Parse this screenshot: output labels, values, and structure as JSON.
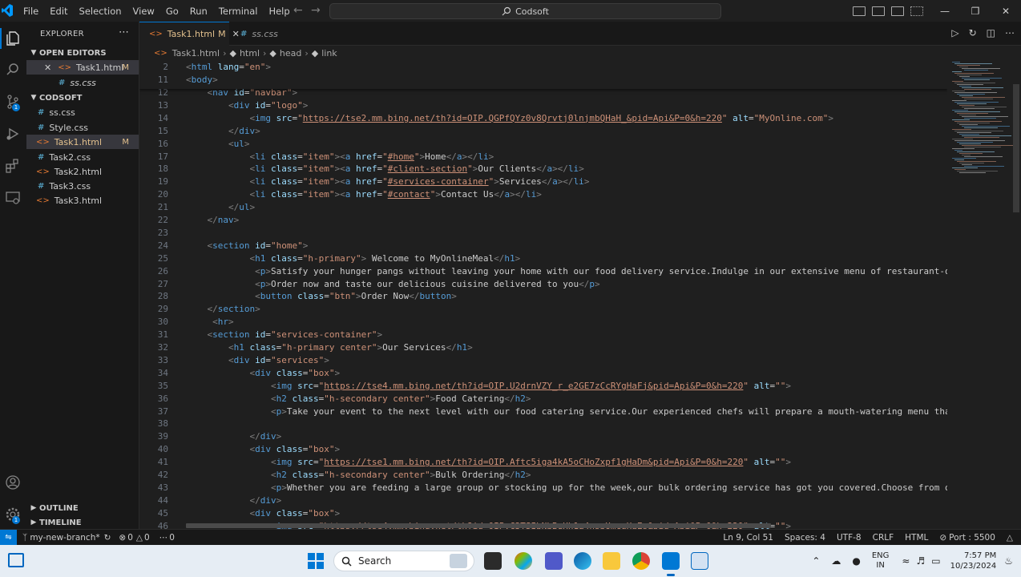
{
  "menu": [
    "File",
    "Edit",
    "Selection",
    "View",
    "Go",
    "Run",
    "Terminal",
    "Help"
  ],
  "command_center": "Codsoft",
  "explorer": {
    "title": "EXPLORER",
    "open_editors_label": "OPEN EDITORS",
    "open_editors": [
      {
        "name": "Task1.html",
        "status": "M"
      },
      {
        "name": "ss.css",
        "status": ""
      }
    ],
    "folder_label": "CODSOFT",
    "files": [
      {
        "name": "ss.css",
        "status": ""
      },
      {
        "name": "Style.css",
        "status": ""
      },
      {
        "name": "Task1.html",
        "status": "M"
      },
      {
        "name": "Task2.css",
        "status": ""
      },
      {
        "name": "Task2.html",
        "status": ""
      },
      {
        "name": "Task3.css",
        "status": ""
      },
      {
        "name": "Task3.html",
        "status": ""
      }
    ],
    "outline_label": "OUTLINE",
    "timeline_label": "TIMELINE"
  },
  "tabs": [
    {
      "name": "Task1.html",
      "status": "M"
    },
    {
      "name": "ss.css",
      "status": ""
    }
  ],
  "breadcrumb": [
    "Task1.html",
    "html",
    "head",
    "link"
  ],
  "code_lines": [
    {
      "n": "2",
      "html": "<span class=\"t\">&lt;</span><span class=\"n\">html</span> <span class=\"a\">lang</span><span class=\"x\">=</span><span class=\"s\">\"en\"</span><span class=\"t\">&gt;</span>"
    },
    {
      "n": "11",
      "html": "<span class=\"t\">&lt;</span><span class=\"n\">body</span><span class=\"t\">&gt;</span>"
    },
    {
      "n": "12",
      "html": "    <span class=\"t\">&lt;</span><span class=\"n\">nav</span> <span class=\"a\">id</span><span class=\"x\">=</span><span class=\"s\">\"navbar\"</span><span class=\"t\">&gt;</span>"
    },
    {
      "n": "13",
      "html": "        <span class=\"t\">&lt;</span><span class=\"n\">div</span> <span class=\"a\">id</span><span class=\"x\">=</span><span class=\"s\">\"logo\"</span><span class=\"t\">&gt;</span>"
    },
    {
      "n": "14",
      "html": "            <span class=\"t\">&lt;</span><span class=\"n\">img</span> <span class=\"a\">src</span><span class=\"x\">=</span><span class=\"s\">\"</span><span class=\"u\">https://tse2.mm.bing.net/th?id=OIP.QGPfQYz0v8Qrvtj0lnjmbQHaH_&amp;pid=Api&amp;P=0&amp;h=220</span><span class=\"s\">\"</span> <span class=\"a\">alt</span><span class=\"x\">=</span><span class=\"s\">\"MyOnline.com\"</span><span class=\"t\">&gt;</span>"
    },
    {
      "n": "15",
      "html": "        <span class=\"t\">&lt;/</span><span class=\"n\">div</span><span class=\"t\">&gt;</span>"
    },
    {
      "n": "16",
      "html": "        <span class=\"t\">&lt;</span><span class=\"n\">ul</span><span class=\"t\">&gt;</span>"
    },
    {
      "n": "17",
      "html": "            <span class=\"t\">&lt;</span><span class=\"n\">li</span> <span class=\"a\">class</span><span class=\"x\">=</span><span class=\"s\">\"item\"</span><span class=\"t\">&gt;&lt;</span><span class=\"n\">a</span> <span class=\"a\">href</span><span class=\"x\">=</span><span class=\"s\">\"</span><span class=\"u\">#home</span><span class=\"s\">\"</span><span class=\"t\">&gt;</span><span class=\"x\">Home</span><span class=\"t\">&lt;/</span><span class=\"n\">a</span><span class=\"t\">&gt;&lt;/</span><span class=\"n\">li</span><span class=\"t\">&gt;</span>"
    },
    {
      "n": "18",
      "html": "            <span class=\"t\">&lt;</span><span class=\"n\">li</span> <span class=\"a\">class</span><span class=\"x\">=</span><span class=\"s\">\"item\"</span><span class=\"t\">&gt;&lt;</span><span class=\"n\">a</span> <span class=\"a\">href</span><span class=\"x\">=</span><span class=\"s\">\"</span><span class=\"u\">#client-section</span><span class=\"s\">\"</span><span class=\"t\">&gt;</span><span class=\"x\">Our Clients</span><span class=\"t\">&lt;/</span><span class=\"n\">a</span><span class=\"t\">&gt;&lt;/</span><span class=\"n\">li</span><span class=\"t\">&gt;</span>"
    },
    {
      "n": "19",
      "html": "            <span class=\"t\">&lt;</span><span class=\"n\">li</span> <span class=\"a\">class</span><span class=\"x\">=</span><span class=\"s\">\"item\"</span><span class=\"t\">&gt;&lt;</span><span class=\"n\">a</span> <span class=\"a\">href</span><span class=\"x\">=</span><span class=\"s\">\"</span><span class=\"u\">#services-container</span><span class=\"s\">\"</span><span class=\"t\">&gt;</span><span class=\"x\">Services</span><span class=\"t\">&lt;/</span><span class=\"n\">a</span><span class=\"t\">&gt;&lt;/</span><span class=\"n\">li</span><span class=\"t\">&gt;</span>"
    },
    {
      "n": "20",
      "html": "            <span class=\"t\">&lt;</span><span class=\"n\">li</span> <span class=\"a\">class</span><span class=\"x\">=</span><span class=\"s\">\"item\"</span><span class=\"t\">&gt;&lt;</span><span class=\"n\">a</span> <span class=\"a\">href</span><span class=\"x\">=</span><span class=\"s\">\"</span><span class=\"u\">#contact</span><span class=\"s\">\"</span><span class=\"t\">&gt;</span><span class=\"x\">Contact Us</span><span class=\"t\">&lt;/</span><span class=\"n\">a</span><span class=\"t\">&gt;&lt;/</span><span class=\"n\">li</span><span class=\"t\">&gt;</span>"
    },
    {
      "n": "21",
      "html": "        <span class=\"t\">&lt;/</span><span class=\"n\">ul</span><span class=\"t\">&gt;</span>"
    },
    {
      "n": "22",
      "html": "    <span class=\"t\">&lt;/</span><span class=\"n\">nav</span><span class=\"t\">&gt;</span>"
    },
    {
      "n": "23",
      "html": ""
    },
    {
      "n": "24",
      "html": "    <span class=\"t\">&lt;</span><span class=\"n\">section</span> <span class=\"a\">id</span><span class=\"x\">=</span><span class=\"s\">\"home\"</span><span class=\"t\">&gt;</span>"
    },
    {
      "n": "25",
      "html": "            <span class=\"t\">&lt;</span><span class=\"n\">h1</span> <span class=\"a\">class</span><span class=\"x\">=</span><span class=\"s\">\"h-primary\"</span><span class=\"t\">&gt;</span><span class=\"x\"> Welcome to MyOnlineMeal</span><span class=\"t\">&lt;/</span><span class=\"n\">h1</span><span class=\"t\">&gt;</span>"
    },
    {
      "n": "26",
      "html": "             <span class=\"t\">&lt;</span><span class=\"n\">p</span><span class=\"t\">&gt;</span><span class=\"x\">Satisfy your hunger pangs without leaving your home with our food delivery service.Indulge in our extensive menu of restaurant-quali</span>"
    },
    {
      "n": "27",
      "html": "             <span class=\"t\">&lt;</span><span class=\"n\">p</span><span class=\"t\">&gt;</span><span class=\"x\">Order now and taste our delicious cuisine delivered to you</span><span class=\"t\">&lt;/</span><span class=\"n\">p</span><span class=\"t\">&gt;</span>"
    },
    {
      "n": "28",
      "html": "             <span class=\"t\">&lt;</span><span class=\"n\">button</span> <span class=\"a\">class</span><span class=\"x\">=</span><span class=\"s\">\"btn\"</span><span class=\"t\">&gt;</span><span class=\"x\">Order Now</span><span class=\"t\">&lt;/</span><span class=\"n\">button</span><span class=\"t\">&gt;</span>"
    },
    {
      "n": "29",
      "html": "    <span class=\"t\">&lt;/</span><span class=\"n\">section</span><span class=\"t\">&gt;</span>"
    },
    {
      "n": "30",
      "html": "     <span class=\"t\">&lt;</span><span class=\"n\">hr</span><span class=\"t\">&gt;</span>"
    },
    {
      "n": "31",
      "html": "    <span class=\"t\">&lt;</span><span class=\"n\">section</span> <span class=\"a\">id</span><span class=\"x\">=</span><span class=\"s\">\"services-container\"</span><span class=\"t\">&gt;</span>"
    },
    {
      "n": "32",
      "html": "        <span class=\"t\">&lt;</span><span class=\"n\">h1</span> <span class=\"a\">class</span><span class=\"x\">=</span><span class=\"s\">\"h-primary center\"</span><span class=\"t\">&gt;</span><span class=\"x\">Our Services</span><span class=\"t\">&lt;/</span><span class=\"n\">h1</span><span class=\"t\">&gt;</span>"
    },
    {
      "n": "33",
      "html": "        <span class=\"t\">&lt;</span><span class=\"n\">div</span> <span class=\"a\">id</span><span class=\"x\">=</span><span class=\"s\">\"services\"</span><span class=\"t\">&gt;</span>"
    },
    {
      "n": "34",
      "html": "            <span class=\"t\">&lt;</span><span class=\"n\">div</span> <span class=\"a\">class</span><span class=\"x\">=</span><span class=\"s\">\"box\"</span><span class=\"t\">&gt;</span>"
    },
    {
      "n": "35",
      "html": "                <span class=\"t\">&lt;</span><span class=\"n\">img</span> <span class=\"a\">src</span><span class=\"x\">=</span><span class=\"s\">\"</span><span class=\"u\">https://tse4.mm.bing.net/th?id=OIP.U2drnVZY_r_e2GE7zCcRYgHaFj&amp;pid=Api&amp;P=0&amp;h=220</span><span class=\"s\">\"</span> <span class=\"a\">alt</span><span class=\"x\">=</span><span class=\"s\">\"\"</span><span class=\"t\">&gt;</span>"
    },
    {
      "n": "36",
      "html": "                <span class=\"t\">&lt;</span><span class=\"n\">h2</span> <span class=\"a\">class</span><span class=\"x\">=</span><span class=\"s\">\"h-secondary center\"</span><span class=\"t\">&gt;</span><span class=\"x\">Food Catering</span><span class=\"t\">&lt;/</span><span class=\"n\">h2</span><span class=\"t\">&gt;</span>"
    },
    {
      "n": "37",
      "html": "                <span class=\"t\">&lt;</span><span class=\"n\">p</span><span class=\"t\">&gt;</span><span class=\"x\">Take your event to the next level with our food catering service.Our experienced chefs will prepare a mouth-watering menu that wi</span>"
    },
    {
      "n": "38",
      "html": ""
    },
    {
      "n": "39",
      "html": "            <span class=\"t\">&lt;/</span><span class=\"n\">div</span><span class=\"t\">&gt;</span>"
    },
    {
      "n": "40",
      "html": "            <span class=\"t\">&lt;</span><span class=\"n\">div</span> <span class=\"a\">class</span><span class=\"x\">=</span><span class=\"s\">\"box\"</span><span class=\"t\">&gt;</span>"
    },
    {
      "n": "41",
      "html": "                <span class=\"t\">&lt;</span><span class=\"n\">img</span> <span class=\"a\">src</span><span class=\"x\">=</span><span class=\"s\">\"</span><span class=\"u\">https://tse1.mm.bing.net/th?id=OIP.Aftc5iga4kA5oCHoZxpf1gHaDm&amp;pid=Api&amp;P=0&amp;h=220</span><span class=\"s\">\"</span> <span class=\"a\">alt</span><span class=\"x\">=</span><span class=\"s\">\"\"</span><span class=\"t\">&gt;</span>"
    },
    {
      "n": "42",
      "html": "                <span class=\"t\">&lt;</span><span class=\"n\">h2</span> <span class=\"a\">class</span><span class=\"x\">=</span><span class=\"s\">\"h-secondary center\"</span><span class=\"t\">&gt;</span><span class=\"x\">Bulk Ordering</span><span class=\"t\">&lt;/</span><span class=\"n\">h2</span><span class=\"t\">&gt;</span>"
    },
    {
      "n": "43",
      "html": "                <span class=\"t\">&lt;</span><span class=\"n\">p</span><span class=\"t\">&gt;</span><span class=\"x\">Whether you are feeding a large group or stocking up for the week,our bulk ordering service has got you covered.Choose from our e</span>"
    },
    {
      "n": "44",
      "html": "            <span class=\"t\">&lt;/</span><span class=\"n\">div</span><span class=\"t\">&gt;</span>"
    },
    {
      "n": "45",
      "html": "            <span class=\"t\">&lt;</span><span class=\"n\">div</span> <span class=\"a\">class</span><span class=\"x\">=</span><span class=\"s\">\"box\"</span><span class=\"t\">&gt;</span>"
    },
    {
      "n": "46",
      "html": "                <span class=\"t\">&lt;</span><span class=\"n\">img</span> <span class=\"a\">src</span><span class=\"x\">=</span><span class=\"s\">\"</span><span class=\"u\">https://tse4.mm.bing.net/th?id=OIP.C3TSIbNbBuHh1a4nspUmcgHaEs&amp;pid=Api&amp;P=0&amp;h=220</span><span class=\"s\">\"</span> <span class=\"a\">alt</span><span class=\"x\">=</span><span class=\"s\">\"\"</span><span class=\"t\">&gt;</span>"
    }
  ],
  "status": {
    "branch": "my-new-branch*",
    "errors": "0",
    "warnings": "0",
    "ports_forwarded": "0",
    "position": "Ln 9, Col 51",
    "spaces": "Spaces: 4",
    "encoding": "UTF-8",
    "eol": "CRLF",
    "language": "HTML",
    "port": "Port : 5500"
  },
  "taskbar": {
    "search_placeholder": "Search",
    "lang_top": "ENG",
    "lang_bottom": "IN",
    "time": "7:57 PM",
    "date": "10/23/2024"
  },
  "colors": {
    "accent": "#0078d4",
    "bg": "#1f1f1f",
    "sidebar": "#181818"
  }
}
